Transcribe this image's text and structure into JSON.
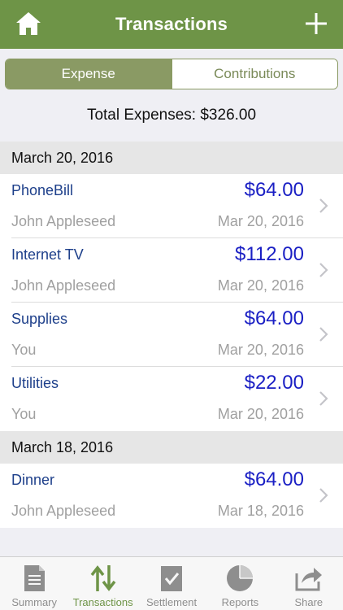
{
  "header": {
    "title": "Transactions"
  },
  "segments": {
    "expense": "Expense",
    "contributions": "Contributions",
    "selected": "Expense"
  },
  "summary": {
    "total": "Total Expenses: $326.00"
  },
  "sections": [
    {
      "date": "March 20, 2016",
      "items": [
        {
          "name": "PhoneBill",
          "amount": "$64.00",
          "person": "John Appleseed",
          "date": "Mar 20, 2016"
        },
        {
          "name": "Internet TV",
          "amount": "$112.00",
          "person": "John Appleseed",
          "date": "Mar 20, 2016"
        },
        {
          "name": "Supplies",
          "amount": "$64.00",
          "person": "You",
          "date": "Mar 20, 2016"
        },
        {
          "name": "Utilities",
          "amount": "$22.00",
          "person": "You",
          "date": "Mar 20, 2016"
        }
      ]
    },
    {
      "date": "March 18, 2016",
      "items": [
        {
          "name": "Dinner",
          "amount": "$64.00",
          "person": "John Appleseed",
          "date": "Mar 18, 2016"
        }
      ]
    }
  ],
  "tabbar": {
    "items": [
      {
        "label": "Summary",
        "icon": "document-icon"
      },
      {
        "label": "Transactions",
        "icon": "transfer-arrows-icon"
      },
      {
        "label": "Settlement",
        "icon": "checklist-icon"
      },
      {
        "label": "Reports",
        "icon": "pie-chart-icon"
      },
      {
        "label": "Share",
        "icon": "share-icon"
      }
    ],
    "active": "Transactions"
  },
  "colors": {
    "nav_bar": "#6e9447",
    "segment_accent": "#8a9a64",
    "amount": "#1a1fc4",
    "item_name": "#1d3f8a",
    "secondary_text": "#a0a0a0"
  }
}
